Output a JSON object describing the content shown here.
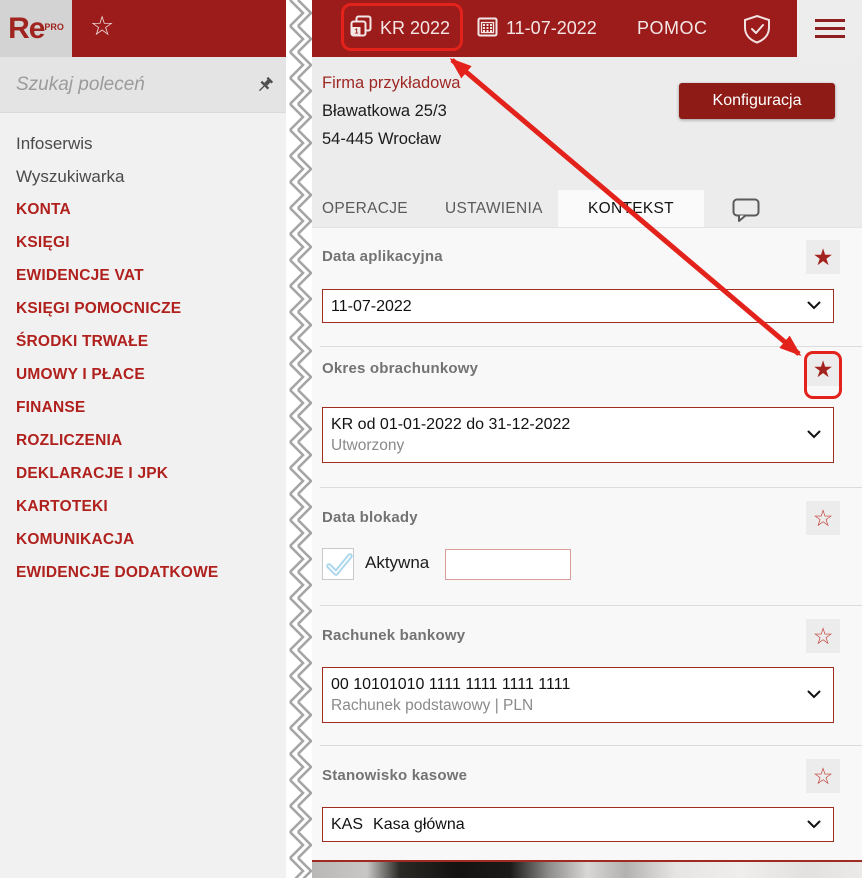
{
  "colors": {
    "topbar_bg": "#9C1C1C",
    "brand_red": "#A02420",
    "menu_item_red": "#B0211E",
    "button_red": "#8E1B16",
    "annotation_red": "#E3221B",
    "select_border_red": "#A02C20",
    "lock_input_border": "#D99C96",
    "checkmark_blue": "#ABD7ED"
  },
  "topbar": {
    "logo": {
      "text": "Re",
      "sup": "PRO"
    },
    "favorites_icon": "star-outline-icon",
    "favorites_glyph": "☆",
    "period_button": {
      "label": "KR 2022",
      "icon": "calendar-stack-icon",
      "badge": "1"
    },
    "date_button": {
      "label": "11-07-2022",
      "icon": "calendar-icon"
    },
    "help_label": "POMOC",
    "security_icon": "shield-check-icon",
    "menu_icon": "hamburger-icon"
  },
  "sidebar": {
    "search": {
      "placeholder": "Szukaj poleceń",
      "value": "",
      "pin_icon": "pushpin-icon"
    },
    "items_plain": [
      "Infoserwis",
      "Wyszukiwarka"
    ],
    "items_modules": [
      "KONTA",
      "KSIĘGI",
      "EWIDENCJE VAT",
      "KSIĘGI POMOCNICZE",
      "ŚRODKI TRWAŁE",
      "UMOWY I PŁACE",
      "FINANSE",
      "ROZLICZENIA",
      "DEKLARACJE I JPK",
      "KARTOTEKI",
      "KOMUNIKACJA",
      "EWIDENCJE DODATKOWE"
    ]
  },
  "main": {
    "company": {
      "name": "Firma przykładowa",
      "address1": "Bławatkowa 25/3",
      "address2": "54-445 Wrocław"
    },
    "config_button": "Konfiguracja",
    "tabs": [
      {
        "label": "OPERACJE",
        "active": false
      },
      {
        "label": "USTAWIENIA",
        "active": false
      },
      {
        "label": "KONTEKST",
        "active": true
      }
    ],
    "feedback_icon": "speech-bubble-icon",
    "sections": {
      "app_date": {
        "label": "Data aplikacyjna",
        "value": "11-07-2022",
        "starred": true,
        "star_glyph": "★"
      },
      "accounting_period": {
        "label": "Okres obrachunkowy",
        "value": "KR od 01-01-2022 do 31-12-2022",
        "status": "Utworzony",
        "starred": true,
        "star_glyph": "★",
        "annotated": true
      },
      "lock_date": {
        "label": "Data blokady",
        "checkbox_label": "Aktywna",
        "checked": true,
        "value": "",
        "starred": false,
        "star_glyph": "☆"
      },
      "bank_account": {
        "label": "Rachunek bankowy",
        "value": "00 10101010 1111 1111 1111 1111",
        "description": "Rachunek podstawowy | PLN",
        "starred": false,
        "star_glyph": "☆"
      },
      "cash_station": {
        "label": "Stanowisko kasowe",
        "code": "KAS",
        "value": "Kasa główna",
        "starred": false,
        "star_glyph": "☆"
      }
    }
  }
}
